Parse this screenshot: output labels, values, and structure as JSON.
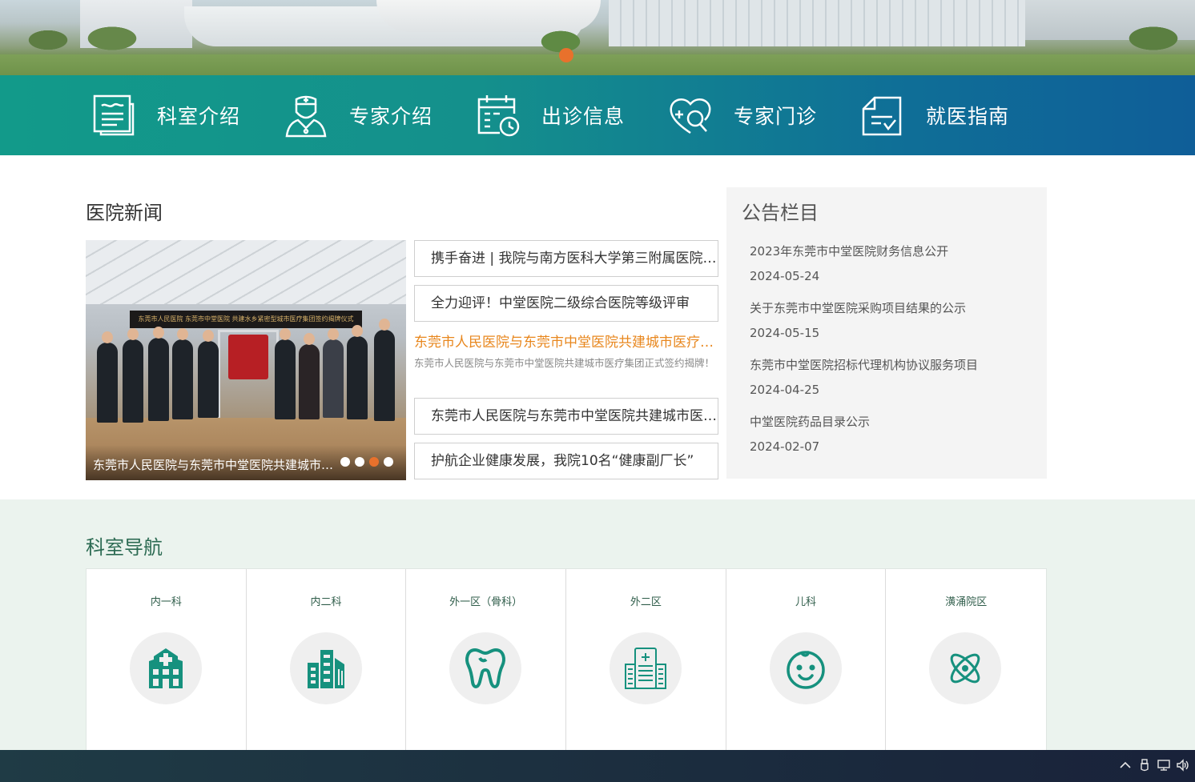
{
  "nav": {
    "items": [
      {
        "label": "科室介绍",
        "icon": "document-icon"
      },
      {
        "label": "专家介绍",
        "icon": "doctor-icon"
      },
      {
        "label": "出诊信息",
        "icon": "calendar-clock-icon"
      },
      {
        "label": "专家门诊",
        "icon": "heart-search-icon"
      },
      {
        "label": "就医指南",
        "icon": "checklist-icon"
      }
    ]
  },
  "news": {
    "title": "医院新闻",
    "photo_caption": "东莞市人民医院与东莞市中堂医院共建城市医疗集团正式签约揭牌！",
    "photo_board": "东莞市人民医院 东莞市中堂医院 共建水乡紧密型城市医疗集团签约揭牌仪式",
    "carousel": {
      "count": 4,
      "active": 3
    },
    "items": [
      "携手奋进 | 我院与南方医科大学第三附属医院签约",
      "全力迎评！中堂医院二级综合医院等级评审",
      "东莞市人民医院与东莞市中堂医院共建城市医疗集团",
      "护航企业健康发展，我院10名“健康副厂长”"
    ],
    "feature": {
      "title": "东莞市人民医院与东莞市中堂医院共建城市医疗集团正式签约揭牌！",
      "desc": "东莞市人民医院与东莞市中堂医院共建城市医疗集团正式签约揭牌！"
    }
  },
  "notice": {
    "title": "公告栏目",
    "items": [
      {
        "title": "2023年东莞市中堂医院财务信息公开",
        "date": "2024-05-24"
      },
      {
        "title": "关于东莞市中堂医院采购项目结果的公示",
        "date": "2024-05-15"
      },
      {
        "title": "东莞市中堂医院招标代理机构协议服务项目",
        "date": "2024-04-25"
      },
      {
        "title": "中堂医院药品目录公示",
        "date": "2024-02-07"
      }
    ]
  },
  "departments": {
    "title": "科室导航",
    "items": [
      {
        "name": "内一科",
        "icon": "hospital-building-icon"
      },
      {
        "name": "内二科",
        "icon": "office-building-icon"
      },
      {
        "name": "外一区（骨科）",
        "icon": "tooth-icon"
      },
      {
        "name": "外二区",
        "icon": "clinic-building-icon"
      },
      {
        "name": "儿科",
        "icon": "baby-face-icon"
      },
      {
        "name": "潢涌院区",
        "icon": "atom-icon"
      }
    ]
  },
  "colors": {
    "nav_start": "#129a8a",
    "nav_end": "#0f5e98",
    "accent_orange": "#e8712c",
    "feature_title": "#e8871e",
    "icon_teal": "#16917e",
    "dept_bg": "#ebf3ee"
  },
  "taskbar": {
    "tray_icons": [
      "chevron-up-icon",
      "usb-icon",
      "network-icon",
      "volume-icon"
    ]
  }
}
